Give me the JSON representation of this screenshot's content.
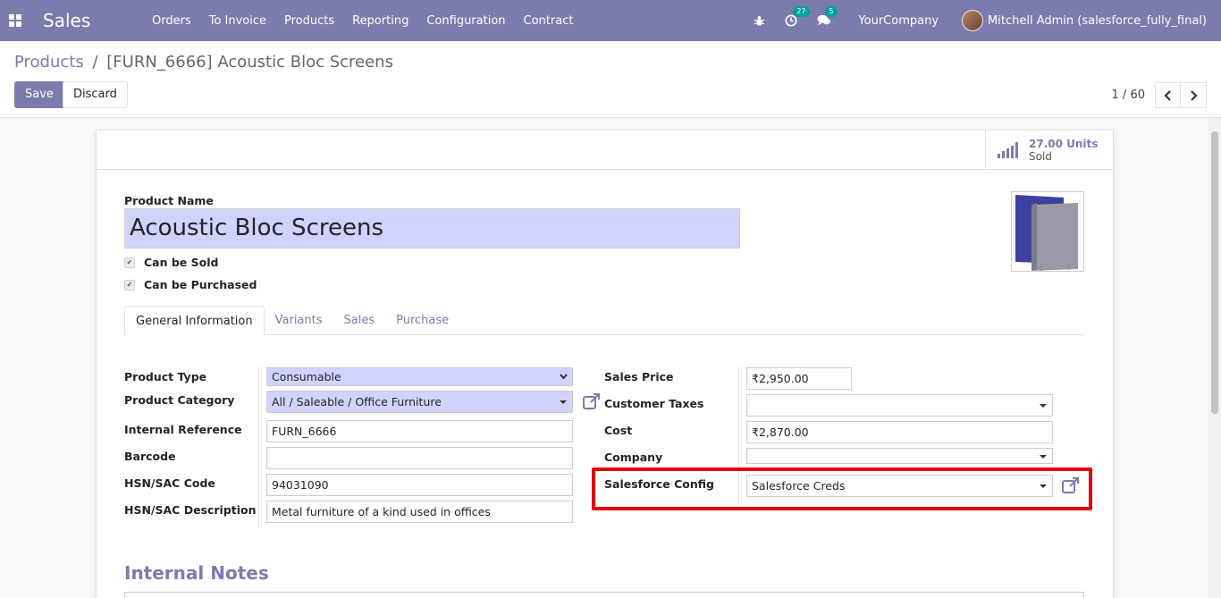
{
  "navbar": {
    "app_name": "Sales",
    "menu": [
      "Orders",
      "To Invoice",
      "Products",
      "Reporting",
      "Configuration",
      "Contract"
    ],
    "activity_count": "27",
    "message_count": "5",
    "company": "YourCompany",
    "user": "Mitchell Admin (salesforce_fully_final)",
    "bg_color": "#7c7bad"
  },
  "breadcrumb": {
    "parent": "Products",
    "separator": "/",
    "current": "[FURN_6666] Acoustic Bloc Screens"
  },
  "actions": {
    "save": "Save",
    "discard": "Discard"
  },
  "pager": {
    "value": "1 / 60"
  },
  "stat_button": {
    "value": "27.00 Units",
    "label": "Sold"
  },
  "product": {
    "name_label": "Product Name",
    "name": "Acoustic Bloc Screens",
    "can_be_sold": "Can be Sold",
    "can_be_purchased": "Can be Purchased"
  },
  "tabs": [
    "General Information",
    "Variants",
    "Sales",
    "Purchase"
  ],
  "left_fields": {
    "product_type": {
      "label": "Product Type",
      "value": "Consumable"
    },
    "product_category": {
      "label": "Product Category",
      "value": "All / Saleable / Office Furniture"
    },
    "internal_reference": {
      "label": "Internal Reference",
      "value": "FURN_6666"
    },
    "barcode": {
      "label": "Barcode",
      "value": ""
    },
    "hsn_code": {
      "label": "HSN/SAC Code",
      "value": "94031090"
    },
    "hsn_description": {
      "label": "HSN/SAC Description",
      "value": "Metal furniture of a kind used in offices"
    }
  },
  "right_fields": {
    "sales_price": {
      "label": "Sales Price",
      "value": "₹2,950.00"
    },
    "customer_taxes": {
      "label": "Customer Taxes",
      "value": ""
    },
    "cost": {
      "label": "Cost",
      "value": "₹2,870.00"
    },
    "company": {
      "label": "Company",
      "value": ""
    },
    "salesforce_config": {
      "label": "Salesforce Config",
      "value": "Salesforce Creds"
    }
  },
  "notes": {
    "title": "Internal Notes"
  },
  "colors": {
    "accent": "#7c7bad",
    "required_bg": "#d2d2ff",
    "highlight": "#e00000",
    "badge": "#00a09d"
  }
}
